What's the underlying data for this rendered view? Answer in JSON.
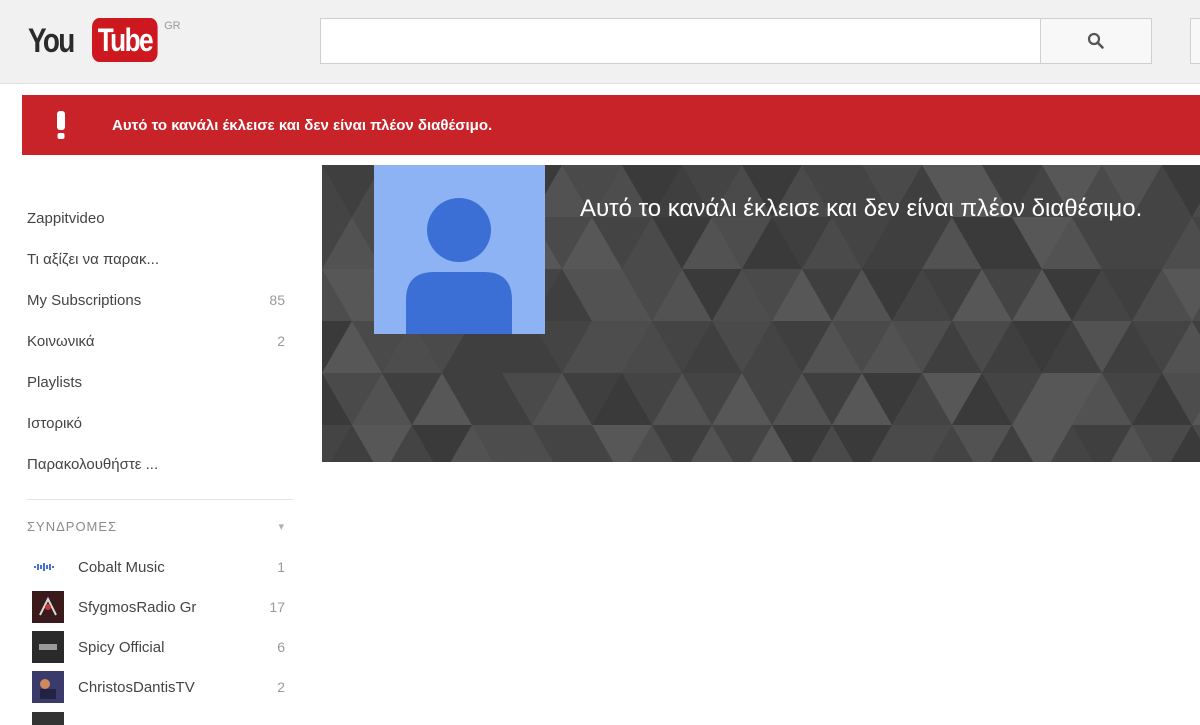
{
  "header": {
    "logo_you": "You",
    "logo_tube": "Tube",
    "logo_country": "GR",
    "search_placeholder": "",
    "search_icon": "search-icon"
  },
  "alert": {
    "icon": "exclamation-icon",
    "message": "Αυτό το κανάλι έκλεισε και δεν είναι πλέον διαθέσιμο."
  },
  "sidebar": {
    "items": [
      {
        "label": "Zappitvideo",
        "count": ""
      },
      {
        "label": "Τι αξίζει να παρακ...",
        "count": ""
      },
      {
        "label": "My Subscriptions",
        "count": "85"
      },
      {
        "label": "Κοινωνικά",
        "count": "2"
      },
      {
        "label": "Playlists",
        "count": ""
      },
      {
        "label": "Ιστορικό",
        "count": ""
      },
      {
        "label": "Παρακολουθήστε ...",
        "count": ""
      }
    ],
    "subscriptions_title": "ΣΥΝΔΡΟΜΕΣ",
    "subscriptions_toggle": "▾",
    "subscriptions": [
      {
        "name": "Cobalt Music",
        "count": "1",
        "thumb_color": "#ffffff"
      },
      {
        "name": "SfygmosRadio Gr",
        "count": "17",
        "thumb_color": "#3a1a1a"
      },
      {
        "name": "Spicy Official",
        "count": "6",
        "thumb_color": "#2a2a2a"
      },
      {
        "name": "ChristosDantisTV",
        "count": "2",
        "thumb_color": "#3b3b6b"
      }
    ]
  },
  "channel": {
    "message": "Αυτό το κανάλι έκλεισε και δεν είναι πλέον διαθέσιμο.",
    "avatar_icon": "default-avatar-icon",
    "banner_color": "#474747",
    "avatar_bg": "#8db3f5",
    "avatar_fg": "#3b6fd6"
  },
  "colors": {
    "alert_red": "#c9232a",
    "brand_red": "#cc181e"
  }
}
